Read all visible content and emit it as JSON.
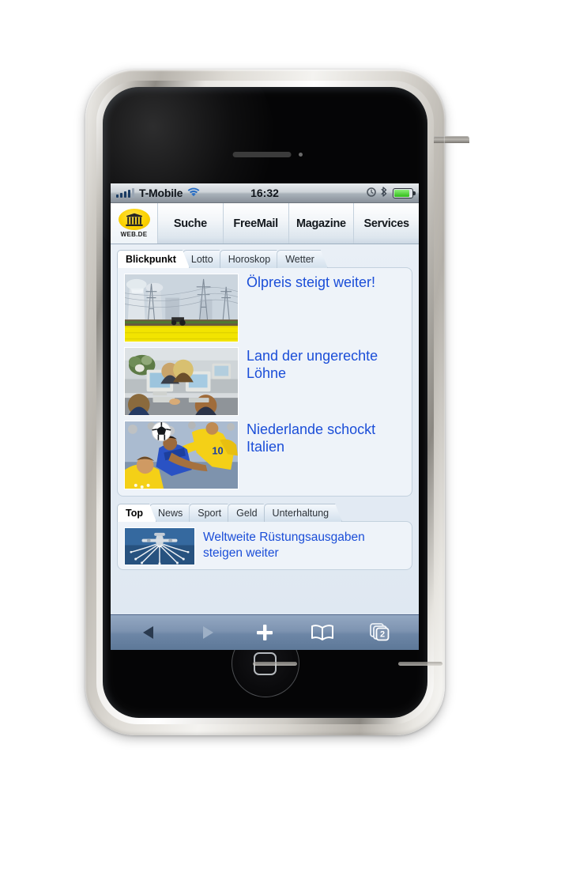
{
  "device": {
    "name": "iPhone",
    "home_button_label": "home-button"
  },
  "statusbar": {
    "carrier": "T-Mobile",
    "time": "16:32",
    "signal_bars_total": 5,
    "signal_bars_filled": 4,
    "icons": [
      "signal-bars-icon",
      "wifi-icon",
      "alarm-clock-icon",
      "bluetooth-icon",
      "battery-icon"
    ],
    "battery_percent": 86
  },
  "site": {
    "logo_word": "WEB.DE",
    "nav": [
      {
        "label": "Suche"
      },
      {
        "label": "FreeMail"
      },
      {
        "label": "Magazine"
      },
      {
        "label": "Services"
      }
    ]
  },
  "blickpunkt": {
    "tabs": [
      {
        "label": "Blickpunkt",
        "active": true
      },
      {
        "label": "Lotto",
        "active": false
      },
      {
        "label": "Horoskop",
        "active": false
      },
      {
        "label": "Wetter",
        "active": false
      }
    ],
    "stories": [
      {
        "headline": "Ölpreis steigt weiter!",
        "image": "power-plant-cooling-towers-rapeseed-field"
      },
      {
        "headline": "Land der ungerechte Löhne",
        "image": "office-workers-at-computers"
      },
      {
        "headline": "Niederlande schockt Italien",
        "image": "soccer-players-heading-ball"
      }
    ]
  },
  "topnews": {
    "tabs": [
      {
        "label": "Top",
        "active": true
      },
      {
        "label": "News",
        "active": false
      },
      {
        "label": "Sport",
        "active": false
      },
      {
        "label": "Geld",
        "active": false
      },
      {
        "label": "Unterhaltung",
        "active": false
      }
    ],
    "stories": [
      {
        "headline": "Weltweite Rüstungsausgaben steigen weiter",
        "image": "military-aircraft-flares"
      }
    ]
  },
  "toolbar": {
    "back_label": "back-icon",
    "forward_label": "forward-icon",
    "add_label": "plus-icon",
    "bookmarks_label": "bookmarks-book-icon",
    "pages_label": "pages-icon",
    "pages_count": "2"
  },
  "colors": {
    "headline_blue": "#1b4ed8",
    "logo_yellow": "#fcd200",
    "toolbar_blue": "#7e94b1",
    "panel_bg": "#eef3f9"
  }
}
